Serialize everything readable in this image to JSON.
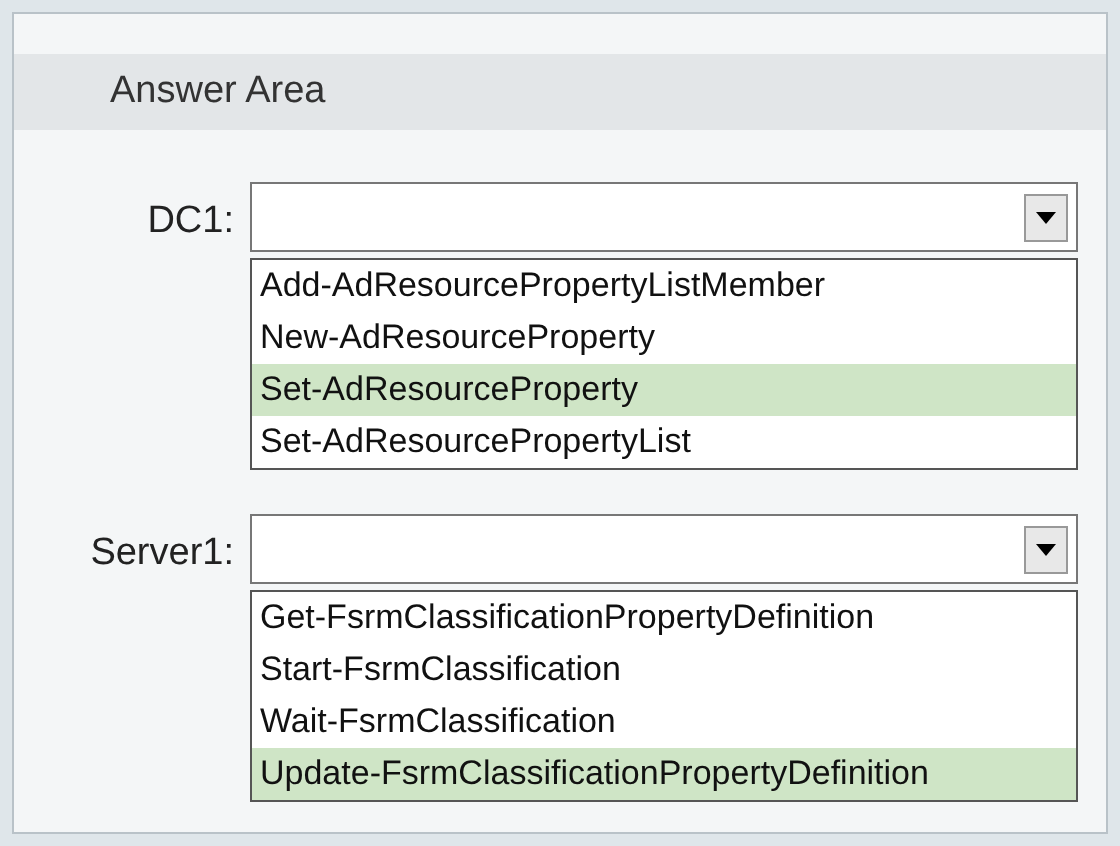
{
  "title": "Answer Area",
  "fields": [
    {
      "label": "DC1:",
      "options": [
        {
          "label": "Add-AdResourcePropertyListMember",
          "selected": false
        },
        {
          "label": "New-AdResourceProperty",
          "selected": false
        },
        {
          "label": "Set-AdResourceProperty",
          "selected": true
        },
        {
          "label": "Set-AdResourcePropertyList",
          "selected": false
        }
      ]
    },
    {
      "label": "Server1:",
      "options": [
        {
          "label": "Get-FsrmClassificationPropertyDefinition",
          "selected": false
        },
        {
          "label": "Start-FsrmClassification",
          "selected": false
        },
        {
          "label": "Wait-FsrmClassification",
          "selected": false
        },
        {
          "label": "Update-FsrmClassificationPropertyDefinition",
          "selected": true
        }
      ]
    }
  ]
}
